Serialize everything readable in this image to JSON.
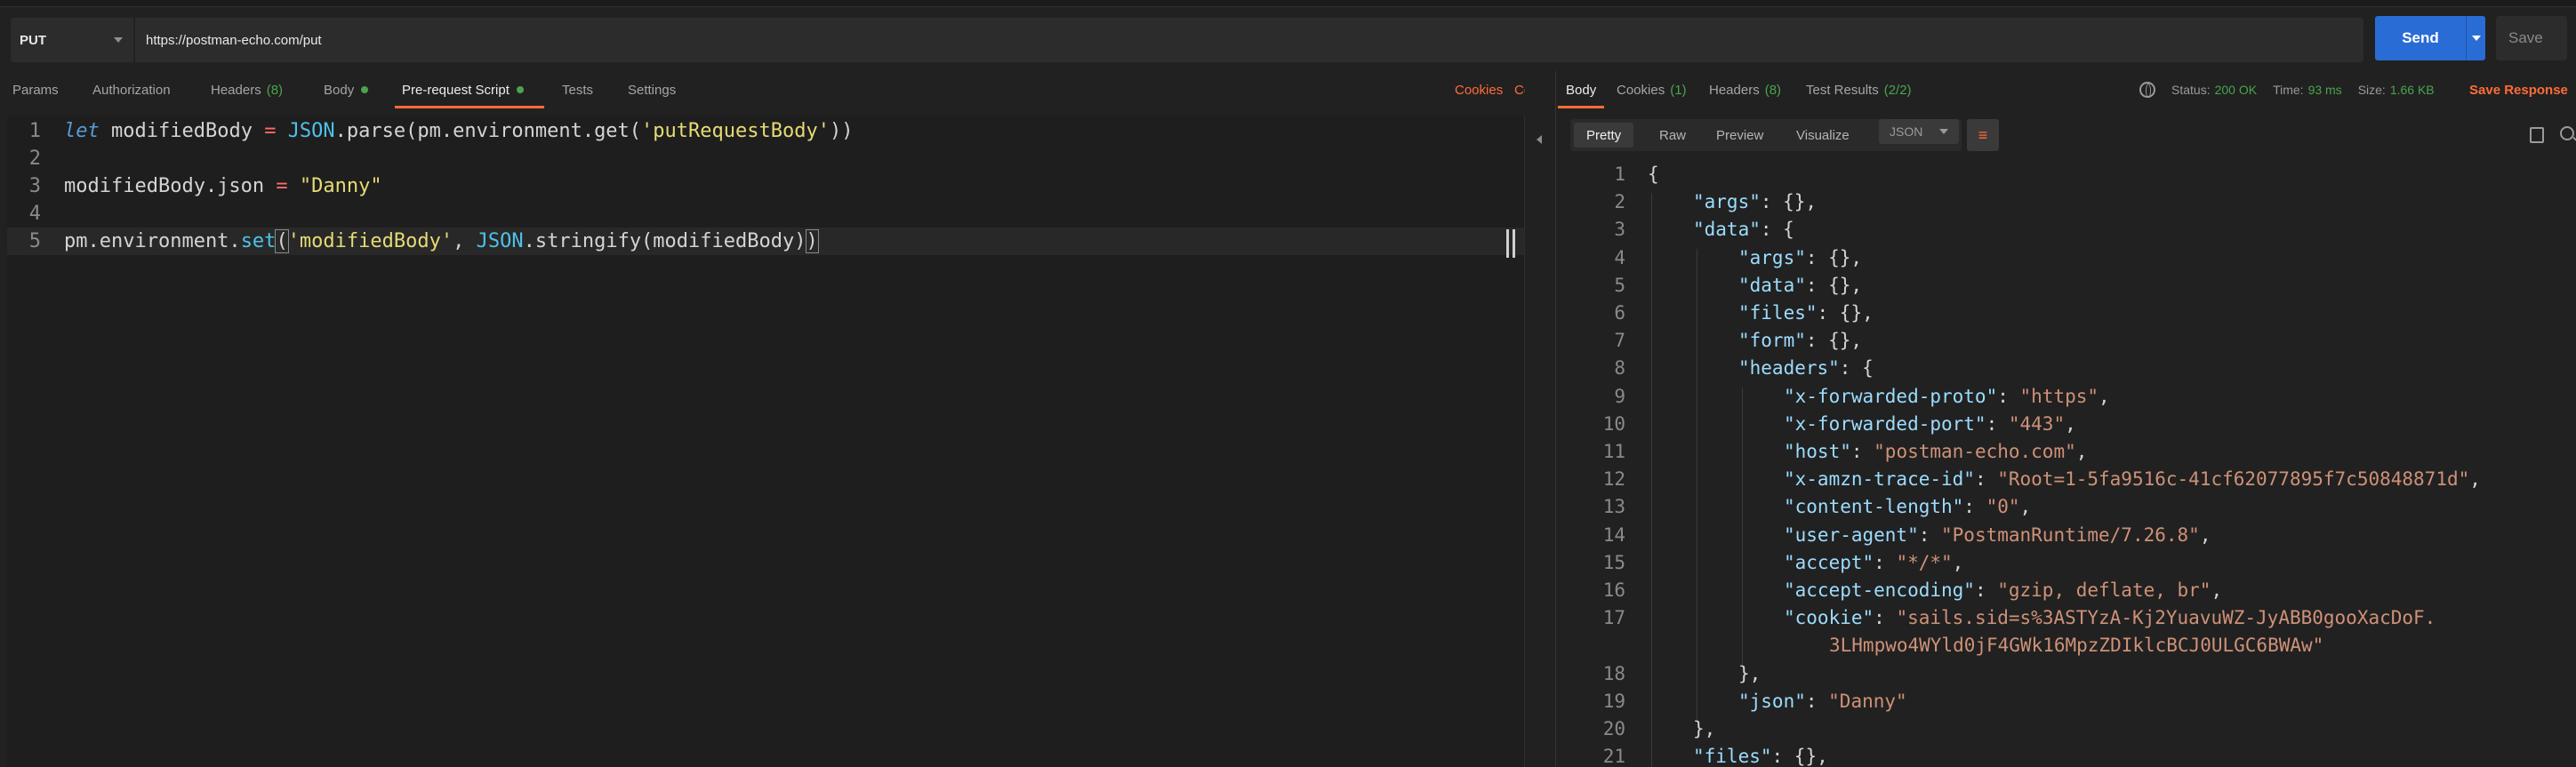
{
  "request": {
    "method": "PUT",
    "url": "https://postman-echo.com/put",
    "send_label": "Send",
    "save_label": "Save"
  },
  "request_tabs": [
    {
      "label": "Params"
    },
    {
      "label": "Authorization"
    },
    {
      "label": "Headers",
      "count": "(8)"
    },
    {
      "label": "Body"
    },
    {
      "label": "Pre-request Script",
      "active": true
    },
    {
      "label": "Tests"
    },
    {
      "label": "Settings"
    }
  ],
  "request_links": {
    "cookies": "Cookies",
    "code": "Code"
  },
  "script_lines": [
    {
      "n": "1",
      "text": "let modifiedBody = JSON.parse(pm.environment.get('putRequestBody'))"
    },
    {
      "n": "2",
      "text": ""
    },
    {
      "n": "3",
      "text": "modifiedBody.json = \"Danny\""
    },
    {
      "n": "4",
      "text": ""
    },
    {
      "n": "5",
      "text": "pm.environment.set('modifiedBody', JSON.stringify(modifiedBody))"
    }
  ],
  "script_tokens": {
    "l1": {
      "kw": "let",
      "a": " modifiedBody ",
      "op": "=",
      "b": " ",
      "obj": "JSON",
      "c": ".parse(pm.environment.get(",
      "str": "'putRequestBody'",
      "d": "))"
    },
    "l3": {
      "a": "modifiedBody.json ",
      "op": "=",
      "b": " ",
      "str": "\"Danny\""
    },
    "l5": {
      "a": "pm.environment.",
      "fn": "set",
      "p1": "(",
      "str": "'modifiedBody'",
      "b": ", ",
      "obj": "JSON",
      "c": ".stringify(modifiedBody)",
      "p2": ")"
    }
  },
  "response_tabs": [
    {
      "label": "Body",
      "active": true
    },
    {
      "label": "Cookies",
      "count": "(1)"
    },
    {
      "label": "Headers",
      "count": "(8)"
    },
    {
      "label": "Test Results",
      "count": "(2/2)"
    }
  ],
  "response_meta": {
    "status_label": "Status:",
    "status": "200 OK",
    "time_label": "Time:",
    "time": "93 ms",
    "size_label": "Size:",
    "size": "1.66 KB",
    "save_response": "Save Response"
  },
  "view_modes": [
    "Pretty",
    "Raw",
    "Preview",
    "Visualize"
  ],
  "format": "JSON",
  "response_lines": [
    {
      "n": "1",
      "indent": 0,
      "parts": [
        [
          "p",
          "{"
        ]
      ]
    },
    {
      "n": "2",
      "indent": 1,
      "parts": [
        [
          "k",
          "\"args\""
        ],
        [
          "p",
          ": {},"
        ]
      ]
    },
    {
      "n": "3",
      "indent": 1,
      "parts": [
        [
          "k",
          "\"data\""
        ],
        [
          "p",
          ": {"
        ]
      ]
    },
    {
      "n": "4",
      "indent": 2,
      "parts": [
        [
          "k",
          "\"args\""
        ],
        [
          "p",
          ": {},"
        ]
      ]
    },
    {
      "n": "5",
      "indent": 2,
      "parts": [
        [
          "k",
          "\"data\""
        ],
        [
          "p",
          ": {},"
        ]
      ]
    },
    {
      "n": "6",
      "indent": 2,
      "parts": [
        [
          "k",
          "\"files\""
        ],
        [
          "p",
          ": {},"
        ]
      ]
    },
    {
      "n": "7",
      "indent": 2,
      "parts": [
        [
          "k",
          "\"form\""
        ],
        [
          "p",
          ": {},"
        ]
      ]
    },
    {
      "n": "8",
      "indent": 2,
      "parts": [
        [
          "k",
          "\"headers\""
        ],
        [
          "p",
          ": {"
        ]
      ]
    },
    {
      "n": "9",
      "indent": 3,
      "parts": [
        [
          "k",
          "\"x-forwarded-proto\""
        ],
        [
          "p",
          ": "
        ],
        [
          "s",
          "\"https\""
        ],
        [
          "p",
          ","
        ]
      ]
    },
    {
      "n": "10",
      "indent": 3,
      "parts": [
        [
          "k",
          "\"x-forwarded-port\""
        ],
        [
          "p",
          ": "
        ],
        [
          "s",
          "\"443\""
        ],
        [
          "p",
          ","
        ]
      ]
    },
    {
      "n": "11",
      "indent": 3,
      "parts": [
        [
          "k",
          "\"host\""
        ],
        [
          "p",
          ": "
        ],
        [
          "s",
          "\"postman-echo.com\""
        ],
        [
          "p",
          ","
        ]
      ]
    },
    {
      "n": "12",
      "indent": 3,
      "parts": [
        [
          "k",
          "\"x-amzn-trace-id\""
        ],
        [
          "p",
          ": "
        ],
        [
          "s",
          "\"Root=1-5fa9516c-41cf62077895f7c50848871d\""
        ],
        [
          "p",
          ","
        ]
      ]
    },
    {
      "n": "13",
      "indent": 3,
      "parts": [
        [
          "k",
          "\"content-length\""
        ],
        [
          "p",
          ": "
        ],
        [
          "s",
          "\"0\""
        ],
        [
          "p",
          ","
        ]
      ]
    },
    {
      "n": "14",
      "indent": 3,
      "parts": [
        [
          "k",
          "\"user-agent\""
        ],
        [
          "p",
          ": "
        ],
        [
          "s",
          "\"PostmanRuntime/7.26.8\""
        ],
        [
          "p",
          ","
        ]
      ]
    },
    {
      "n": "15",
      "indent": 3,
      "parts": [
        [
          "k",
          "\"accept\""
        ],
        [
          "p",
          ": "
        ],
        [
          "s",
          "\"*/*\""
        ],
        [
          "p",
          ","
        ]
      ]
    },
    {
      "n": "16",
      "indent": 3,
      "parts": [
        [
          "k",
          "\"accept-encoding\""
        ],
        [
          "p",
          ": "
        ],
        [
          "s",
          "\"gzip, deflate, br\""
        ],
        [
          "p",
          ","
        ]
      ]
    },
    {
      "n": "17",
      "indent": 3,
      "parts": [
        [
          "k",
          "\"cookie\""
        ],
        [
          "p",
          ": "
        ],
        [
          "s",
          "\"sails.sid=s%3ASTYzA-Kj2YuavuWZ-JyABB0gooXacDoF."
        ]
      ]
    },
    {
      "n": "",
      "indent": 4,
      "parts": [
        [
          "s",
          "3LHmpwo4WYld0jF4GWk16MpzZDIklcBCJ0ULGC6BWAw\""
        ]
      ]
    },
    {
      "n": "18",
      "indent": 2,
      "parts": [
        [
          "p",
          "},"
        ]
      ]
    },
    {
      "n": "19",
      "indent": 2,
      "parts": [
        [
          "k",
          "\"json\""
        ],
        [
          "p",
          ": "
        ],
        [
          "s",
          "\"Danny\""
        ]
      ]
    },
    {
      "n": "20",
      "indent": 1,
      "parts": [
        [
          "p",
          "},"
        ]
      ]
    },
    {
      "n": "21",
      "indent": 1,
      "parts": [
        [
          "k",
          "\"files\""
        ],
        [
          "p",
          ": {},"
        ]
      ]
    }
  ],
  "colors": {
    "accent": "#ff6c37",
    "primary": "#2a6cd6",
    "success": "#49a54d"
  }
}
